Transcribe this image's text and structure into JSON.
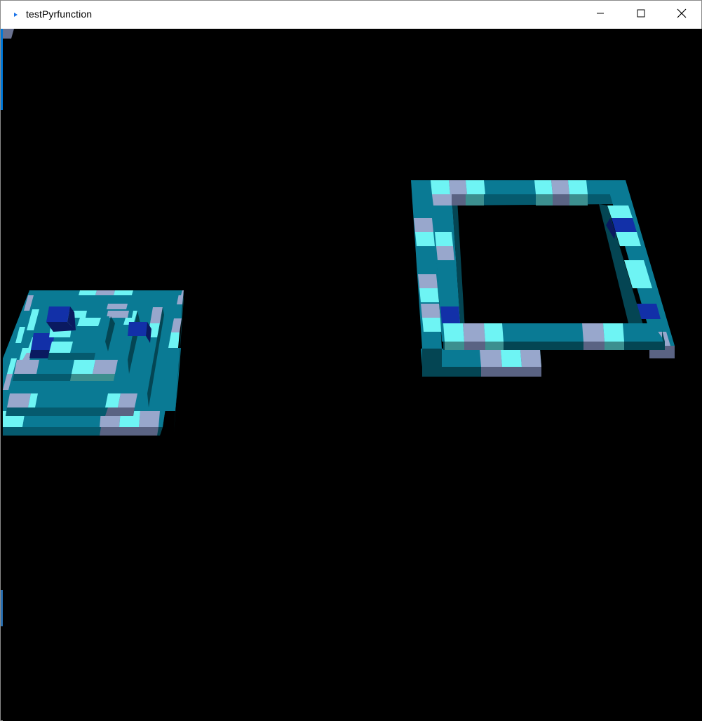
{
  "window": {
    "title": "testPyrfunction",
    "icon": "app-arrow-icon",
    "controls": {
      "minimize_icon": "minimize-icon",
      "maximize_icon": "maximize-icon",
      "close_icon": "close-icon"
    }
  },
  "scene": {
    "background": "#000000",
    "palette": {
      "teal": "#0a7a94",
      "teal_dark": "#055a6e",
      "teal_side": "#044553",
      "cyan": "#6ef4f4",
      "cyan_side": "#3c8f8f",
      "lavender": "#98a7cc",
      "lavender_side": "#5a6383",
      "blue": "#1230a8",
      "blue_side": "#0a1a60"
    },
    "objects": [
      "stepped-pyramid",
      "square-ring-frame"
    ]
  }
}
